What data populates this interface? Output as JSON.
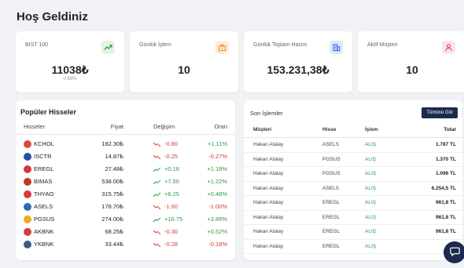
{
  "page": {
    "title": "Hoş Geldiniz"
  },
  "stats": [
    {
      "label": "BIST 100",
      "value": "11038₺",
      "sub": "0.68%",
      "icon": "trend-up-icon"
    },
    {
      "label": "Günlük İşlem",
      "value": "10",
      "icon": "briefcase-icon"
    },
    {
      "label": "Günlük Toplam Hacim",
      "value": "153.231,38₺",
      "icon": "building-icon"
    },
    {
      "label": "Aktif Müşteri",
      "value": "10",
      "icon": "users-icon"
    }
  ],
  "popular": {
    "title": "Popüler Hisseler",
    "headers": {
      "stock": "Hisseler",
      "price": "Fiyat",
      "change": "Değişim",
      "pct": "Oran"
    },
    "rows": [
      {
        "ticker": "KCHOL",
        "price": "182.30₺",
        "change": "-0.80",
        "pct": "+1.11%",
        "logo": "#d94b3a"
      },
      {
        "ticker": "ISCTR",
        "price": "14.87₺",
        "change": "-0.25",
        "pct": "-0.27%",
        "logo": "#2b4fa0"
      },
      {
        "ticker": "EREGL",
        "price": "27.48₺",
        "change": "+0.18",
        "pct": "+1.18%",
        "logo": "#d13b3b"
      },
      {
        "ticker": "BIMAS",
        "price": "538.00₺",
        "change": "+7.50",
        "pct": "+1.22%",
        "logo": "#c0392b"
      },
      {
        "ticker": "THYAO",
        "price": "315.75₺",
        "change": "+6.25",
        "pct": "+0.48%",
        "logo": "#d93a3a"
      },
      {
        "ticker": "ASELS",
        "price": "178.70₺",
        "change": "-1.60",
        "pct": "-1.00%",
        "logo": "#2c6cb0"
      },
      {
        "ticker": "PGSUS",
        "price": "274.00₺",
        "change": "+16.75",
        "pct": "+3.89%",
        "logo": "#f2a91b"
      },
      {
        "ticker": "AKBNK",
        "price": "68.25₺",
        "change": "-0.30",
        "pct": "+0.52%",
        "logo": "#d63b3b"
      },
      {
        "ticker": "YKBNK",
        "price": "33.44₺",
        "change": "-0.28",
        "pct": "-0.18%",
        "logo": "#3a5a8c"
      }
    ]
  },
  "recent": {
    "title": "Son İşlemler",
    "view_all": "Tümünü Gör",
    "headers": {
      "customer": "Müşteri",
      "stock": "Hisse",
      "action": "İşlem",
      "amount": "Tutar"
    },
    "rows": [
      {
        "customer": "Hakan Atalay",
        "stock": "ASELS",
        "action": "ALIŞ",
        "amount": "1.787 TL"
      },
      {
        "customer": "Hakan Atalay",
        "stock": "PGSUS",
        "action": "ALIŞ",
        "amount": "1.370 TL"
      },
      {
        "customer": "Hakan Atalay",
        "stock": "PGSUS",
        "action": "ALIŞ",
        "amount": "1.096 TL"
      },
      {
        "customer": "Hakan Atalay",
        "stock": "ASELS",
        "action": "ALIŞ",
        "amount": "6.254,5 TL"
      },
      {
        "customer": "Hakan Atalay",
        "stock": "EREGL",
        "action": "ALIŞ",
        "amount": "961,8 TL"
      },
      {
        "customer": "Hakan Atalay",
        "stock": "EREGL",
        "action": "ALIŞ",
        "amount": "961,8 TL"
      },
      {
        "customer": "Hakan Atalay",
        "stock": "EREGL",
        "action": "ALIŞ",
        "amount": "961,8 TL"
      },
      {
        "customer": "Hakan Atalay",
        "stock": "EREGL",
        "action": "ALIŞ",
        "amount": "961"
      }
    ]
  },
  "colors": {
    "up": "#2e9a44",
    "down": "#d63b3b",
    "navy": "#1b2a4e"
  },
  "chat": {
    "icon": "chat-icon"
  }
}
